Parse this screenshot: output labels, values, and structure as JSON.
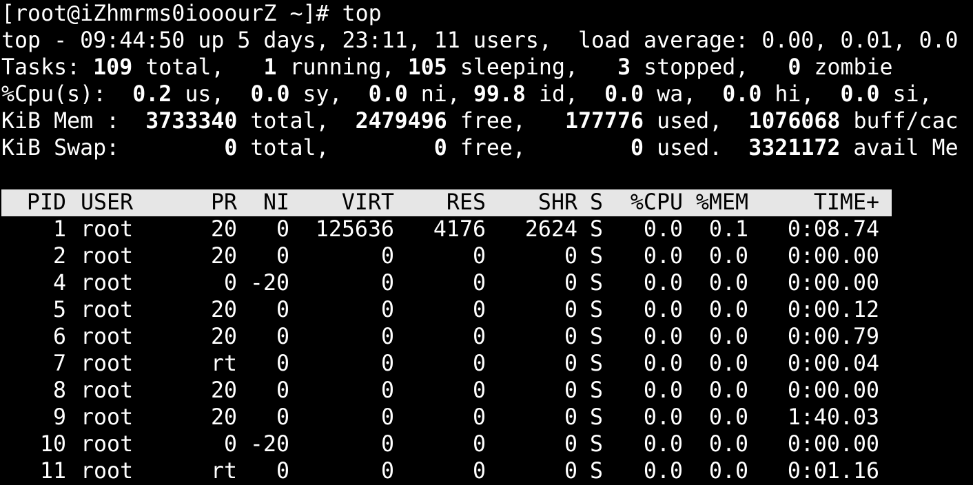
{
  "terminal": {
    "prompt": "[root@iZhmrms0iooourZ ~]# top",
    "summary": {
      "top_line": "top - 09:44:50 up 5 days, 23:11, 11 users,  load average: 0.00, 0.01, 0.0",
      "tasks": {
        "label": "Tasks: ",
        "total": "109",
        "total_suffix": " total,   ",
        "running": "1",
        "running_suffix": " running, ",
        "sleeping": "105",
        "sleeping_suffix": " sleeping,   ",
        "stopped": "3",
        "stopped_suffix": " stopped,   ",
        "zombie": "0",
        "zombie_suffix": " zombie"
      },
      "cpu": {
        "label": "%Cpu(s):  ",
        "us": "0.2",
        "us_suffix": " us,  ",
        "sy": "0.0",
        "sy_suffix": " sy,  ",
        "ni": "0.0",
        "ni_suffix": " ni, ",
        "id": "99.8",
        "id_suffix": " id,  ",
        "wa": "0.0",
        "wa_suffix": " wa,  ",
        "hi": "0.0",
        "hi_suffix": " hi,  ",
        "si": "0.0",
        "si_suffix": " si,"
      },
      "mem": {
        "label": "KiB Mem :  ",
        "total": "3733340",
        "total_suffix": " total,  ",
        "free": "2479496",
        "free_suffix": " free,   ",
        "used": "177776",
        "used_suffix": " used,  ",
        "buff": "1076068",
        "buff_suffix": " buff/cac"
      },
      "swap": {
        "label": "KiB Swap:        ",
        "total": "0",
        "total_suffix": " total,        ",
        "free": "0",
        "free_suffix": " free,        ",
        "used": "0",
        "used_suffix": " used.  ",
        "avail": "3321172",
        "avail_suffix": " avail Me"
      }
    },
    "table": {
      "columns": [
        "PID",
        "USER",
        "PR",
        "NI",
        "VIRT",
        "RES",
        "SHR",
        "S",
        "%CPU",
        "%MEM",
        "TIME+"
      ],
      "rows": [
        [
          "1",
          "root",
          "20",
          "0",
          "125636",
          "4176",
          "2624",
          "S",
          "0.0",
          "0.1",
          "0:08.74"
        ],
        [
          "2",
          "root",
          "20",
          "0",
          "0",
          "0",
          "0",
          "S",
          "0.0",
          "0.0",
          "0:00.00"
        ],
        [
          "4",
          "root",
          "0",
          "-20",
          "0",
          "0",
          "0",
          "S",
          "0.0",
          "0.0",
          "0:00.00"
        ],
        [
          "5",
          "root",
          "20",
          "0",
          "0",
          "0",
          "0",
          "S",
          "0.0",
          "0.0",
          "0:00.12"
        ],
        [
          "6",
          "root",
          "20",
          "0",
          "0",
          "0",
          "0",
          "S",
          "0.0",
          "0.0",
          "0:00.79"
        ],
        [
          "7",
          "root",
          "rt",
          "0",
          "0",
          "0",
          "0",
          "S",
          "0.0",
          "0.0",
          "0:00.04"
        ],
        [
          "8",
          "root",
          "20",
          "0",
          "0",
          "0",
          "0",
          "S",
          "0.0",
          "0.0",
          "0:00.00"
        ],
        [
          "9",
          "root",
          "20",
          "0",
          "0",
          "0",
          "0",
          "S",
          "0.0",
          "0.0",
          "1:40.03"
        ],
        [
          "10",
          "root",
          "0",
          "-20",
          "0",
          "0",
          "0",
          "S",
          "0.0",
          "0.0",
          "0:00.00"
        ],
        [
          "11",
          "root",
          "rt",
          "0",
          "0",
          "0",
          "0",
          "S",
          "0.0",
          "0.0",
          "0:01.16"
        ]
      ]
    },
    "colors": {
      "background": "#000000",
      "foreground": "#ffffff",
      "header_bar": "#e6e6e6",
      "header_text": "#000000"
    }
  }
}
